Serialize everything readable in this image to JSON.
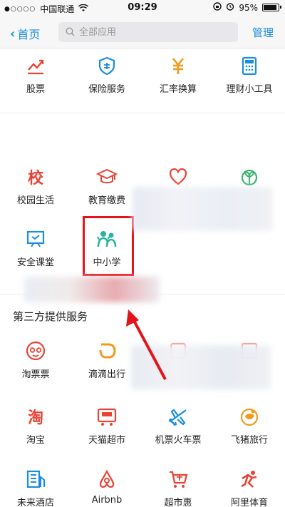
{
  "status": {
    "carrier": "中国联通",
    "time": "09:29",
    "battery": "95%"
  },
  "nav": {
    "back_label": "首页",
    "search_placeholder": "全部应用",
    "manage_label": "管理"
  },
  "row1": [
    {
      "label": "股票",
      "icon": "stock-chart-icon",
      "color": "#e94335"
    },
    {
      "label": "保险服务",
      "icon": "insurance-shield-icon",
      "color": "#1a8de0"
    },
    {
      "label": "汇率换算",
      "icon": "yen-icon",
      "color": "#f29a1c"
    },
    {
      "label": "理财小工具",
      "icon": "calculator-icon",
      "color": "#1a8de0"
    }
  ],
  "row2": [
    {
      "label": "校园生活",
      "icon": "campus-icon",
      "color": "#e94335"
    },
    {
      "label": "教育缴费",
      "icon": "graduation-cap-icon",
      "color": "#e94335"
    },
    {
      "label": "",
      "icon": "heart-icon",
      "color": "#e94335"
    },
    {
      "label": "",
      "icon": "sprout-icon",
      "color": "#3cb371"
    }
  ],
  "row3": [
    {
      "label": "安全课堂",
      "icon": "classroom-board-icon",
      "color": "#1a8de0"
    },
    {
      "label": "中小学",
      "icon": "students-icon",
      "color": "#2ab3a0"
    }
  ],
  "section_title": "第三方提供服务",
  "row4": [
    {
      "label": "淘票票",
      "icon": "taopiaopiao-icon",
      "color": "#e94335"
    },
    {
      "label": "滴滴出行",
      "icon": "didi-icon",
      "color": "#f29a1c"
    },
    {
      "label": "",
      "icon": "blurred-icon",
      "color": "#e94335"
    },
    {
      "label": "",
      "icon": "blurred-icon",
      "color": "#e94335"
    }
  ],
  "row5": [
    {
      "label": "淘宝",
      "icon": "taobao-icon",
      "color": "#e94335"
    },
    {
      "label": "天猫超市",
      "icon": "tmall-supermarket-icon",
      "color": "#e94335"
    },
    {
      "label": "机票火车票",
      "icon": "airplane-icon",
      "color": "#1a8de0"
    },
    {
      "label": "飞猪旅行",
      "icon": "fliggy-icon",
      "color": "#f29a1c"
    }
  ],
  "row6": [
    {
      "label": "未来酒店",
      "icon": "hotel-icon",
      "color": "#1a8de0"
    },
    {
      "label": "Airbnb",
      "icon": "airbnb-icon",
      "color": "#e94335"
    },
    {
      "label": "超市惠",
      "icon": "cart-icon",
      "color": "#e94335"
    },
    {
      "label": "阿里体育",
      "icon": "sports-icon",
      "color": "#e94335"
    }
  ]
}
